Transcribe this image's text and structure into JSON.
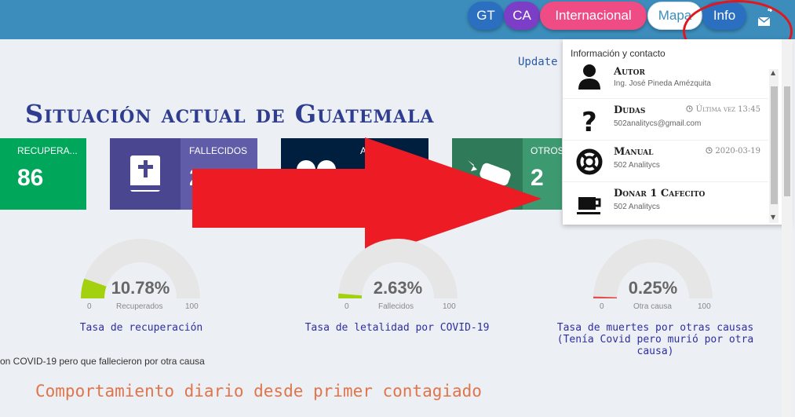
{
  "nav": {
    "gt": "GT",
    "ca": "CA",
    "internacional": "Internacional",
    "mapa": "Mapa",
    "info": "Info",
    "mail_count": "4"
  },
  "update_text": "Update (",
  "page_title": "Situación actual de Guatemala",
  "stats": [
    {
      "label": "RECUPERA...",
      "value": "86",
      "color": "#00a65a",
      "icon": "recovered-icon"
    },
    {
      "label": "FALLECIDOS",
      "value": "2",
      "color": "#605ca8",
      "icon": "bible-icon"
    },
    {
      "label": "A...",
      "value": "",
      "color": "#001f3f",
      "icon": "active-icon"
    },
    {
      "label": "OTROS",
      "value": "2",
      "color": "#3d9970",
      "icon": "car-crash-icon"
    }
  ],
  "gauges": [
    {
      "percent": "10.78%",
      "value": 10.78,
      "caption": "Recuperados",
      "min": "0",
      "max": "100",
      "title": "Tasa de recuperación"
    },
    {
      "percent": "2.63%",
      "value": 2.63,
      "caption": "Fallecidos",
      "min": "0",
      "max": "100",
      "title": "Tasa de letalidad por COVID-19"
    },
    {
      "percent": "0.25%",
      "value": 0.25,
      "caption": "Otra causa",
      "min": "0",
      "max": "100",
      "title": "Tasa de muertes por otras causas (Tenía Covid pero murió por otra causa)"
    }
  ],
  "note": "on COVID-19 pero que fallecieron por otra causa",
  "section_title": "Comportamiento diario desde primer contagiado",
  "dropdown": {
    "header": "Información y contacto",
    "items": [
      {
        "title": "Autor",
        "sub": "Ing. José Pineda Amézquita",
        "meta": "",
        "icon": "person-icon"
      },
      {
        "title": "Dudas",
        "sub": "502analitycs@gmail.com",
        "meta": "Última vez 13:45",
        "icon": "question-icon"
      },
      {
        "title": "Manual",
        "sub": "502 Analitycs",
        "meta": "2020-03-19",
        "icon": "lifebuoy-icon"
      },
      {
        "title": "Donar 1 Cafecito",
        "sub": "502 Analitycs",
        "meta": "",
        "icon": "coffee-icon"
      }
    ]
  },
  "colors": {
    "topbar": "#3c8dbc",
    "annotation_red": "#e0171c",
    "gauge_fill": "#a3d10e"
  }
}
